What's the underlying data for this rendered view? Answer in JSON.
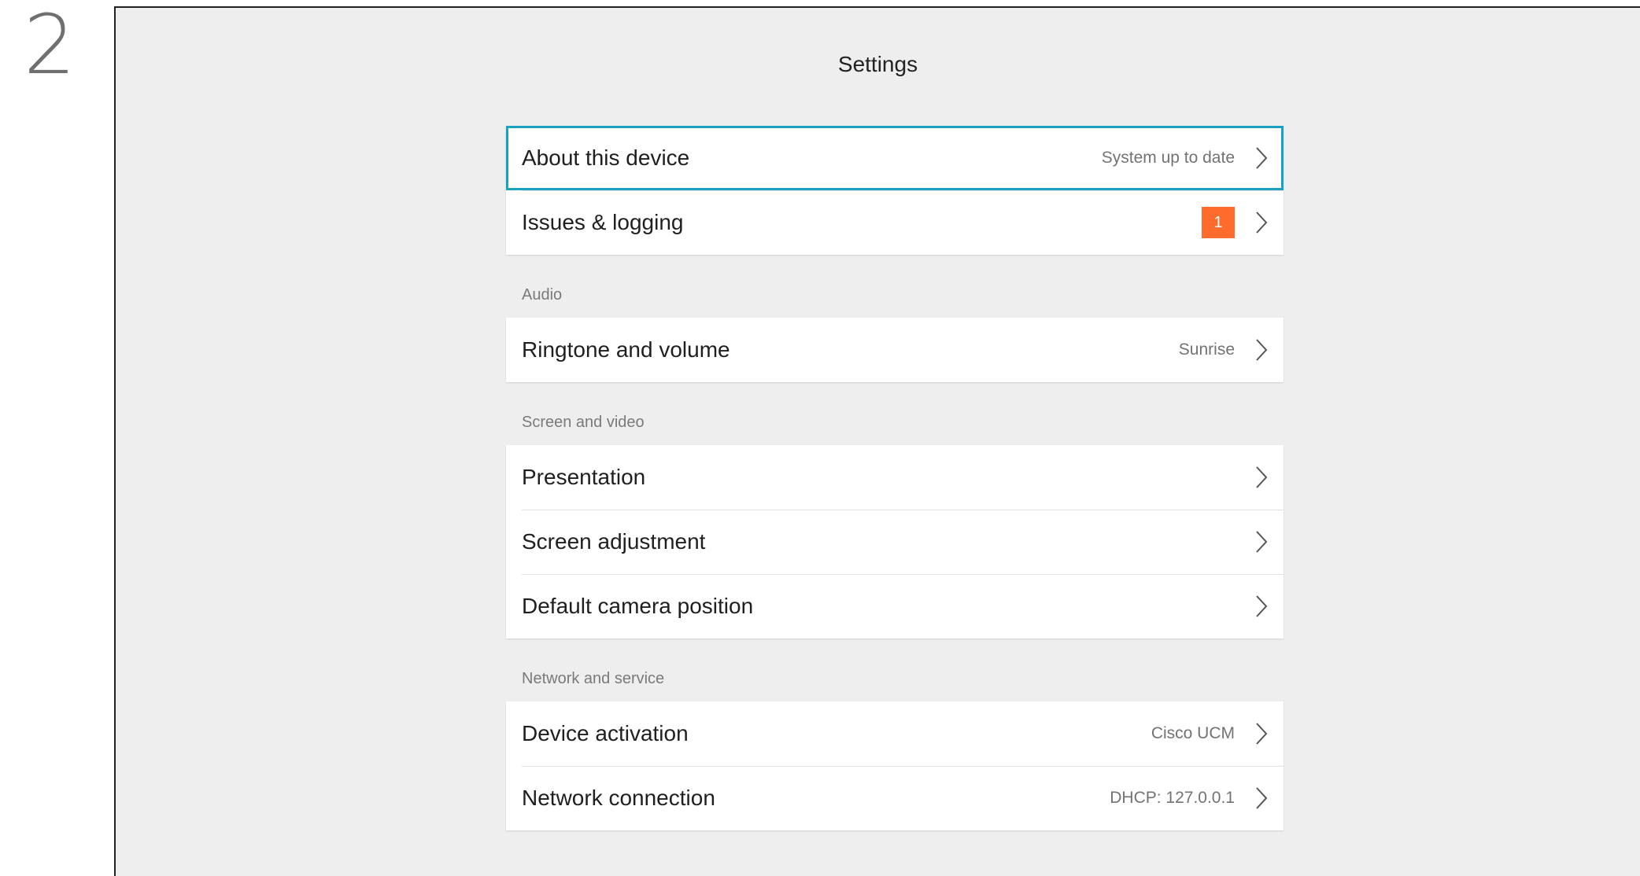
{
  "step": {
    "number": "2"
  },
  "settings": {
    "title": "Settings",
    "top_group": [
      {
        "label": "About this device",
        "value": "System up to date",
        "selected": true
      },
      {
        "label": "Issues & logging",
        "badge": "1"
      }
    ],
    "audio": {
      "header": "Audio",
      "items": [
        {
          "label": "Ringtone and volume",
          "value": "Sunrise"
        }
      ]
    },
    "screen_video": {
      "header": "Screen and video",
      "items": [
        {
          "label": "Presentation"
        },
        {
          "label": "Screen adjustment"
        },
        {
          "label": "Default camera position"
        }
      ]
    },
    "network": {
      "header": "Network and service",
      "items": [
        {
          "label": "Device activation",
          "value": "Cisco UCM"
        },
        {
          "label": "Network connection",
          "value": "DHCP: 127.0.0.1"
        }
      ]
    }
  },
  "icons": {
    "row_arrow": "chevron-right-icon"
  },
  "colors": {
    "selection": "#1aa1c1",
    "badge": "#ff6b2c",
    "background": "#eeeeee"
  }
}
